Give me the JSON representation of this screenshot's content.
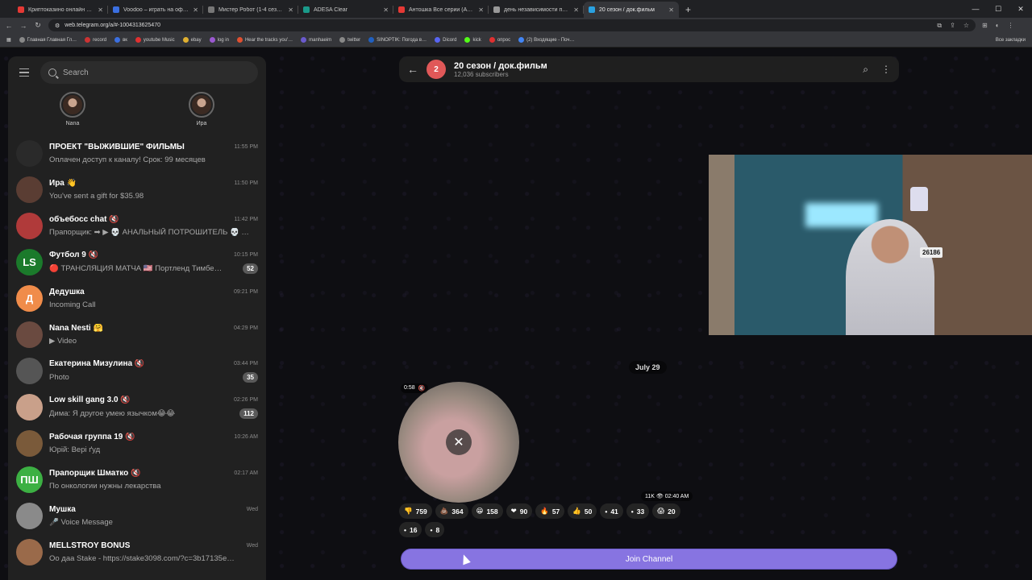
{
  "browser": {
    "tabs": [
      {
        "title": "Криптоказино онлайн VAVADA",
        "color": "#e53935"
      },
      {
        "title": "Voodoo – играть на официальн…",
        "color": "#3b6fe0"
      },
      {
        "title": "Мистер Робот (1-4 сезон) смотр…",
        "color": "#777777"
      },
      {
        "title": "ADESA Clear",
        "color": "#1a9a8a"
      },
      {
        "title": "Антошка Все серии (Antoshka)",
        "color": "#e53935"
      },
      {
        "title": "день независимости пакистан…",
        "color": "#999999"
      },
      {
        "title": "20 сезон / док.фильм",
        "color": "#2aa1e0"
      }
    ],
    "new_tab": "+",
    "url": "web.telegram.org/a/#-1004313625470",
    "bookmarks": [
      "Главная Главная Гл…",
      "record",
      "вк",
      "youtube Music",
      "ebay",
      "log in",
      "Hear the tracks you'…",
      "manhaeim",
      "twitter",
      "SINOPTIK: Погода в…",
      "Dicord",
      "kick",
      "опрос",
      "(2) Входящие - Поч…"
    ],
    "all_bookmarks": "Все закладки"
  },
  "sidebar": {
    "search_placeholder": "Search",
    "stories": [
      {
        "name": "Nana"
      },
      {
        "name": "Ира"
      }
    ],
    "chats": [
      {
        "name": "ПРОЕКТ \"ВЫЖИВШИЕ\" ФИЛЬМЫ",
        "preview": "Оплачен доступ к каналу! Срок: 99 месяцев",
        "time": "11:55 PM",
        "badge": "",
        "avatar_color": "#2a2a2a",
        "avatar_text": ""
      },
      {
        "name": "Ира 👋",
        "preview": "You've sent a gift for $35.98",
        "time": "11:50 PM",
        "badge": "",
        "avatar_color": "#5a3d33",
        "avatar_text": ""
      },
      {
        "name": "объебосс chat 🔇",
        "preview": "Прапорщик: ➡ ▶ 💀 АНАЛЬНЫЙ ПОТРОШИТЕЛЬ 💀 …",
        "time": "11:42 PM",
        "badge": "",
        "avatar_color": "#b03a3a",
        "avatar_text": ""
      },
      {
        "name": "Футбол 9 🔇",
        "preview": "🔴 ТРАНСЛЯЦИЯ МАТЧА 🇺🇸 Портленд Тимбе…",
        "time": "10:15 PM",
        "badge": "52",
        "avatar_color": "#1b7a2b",
        "avatar_text": "LS"
      },
      {
        "name": "Дедушка",
        "preview": "Incoming Call",
        "time": "09:21 PM",
        "badge": "",
        "avatar_color": "#f08c4a",
        "avatar_text": "Д"
      },
      {
        "name": "Nana Nesti 🤗",
        "preview": "▶ Video",
        "time": "04:29 PM",
        "badge": "",
        "avatar_color": "#6a4a40",
        "avatar_text": ""
      },
      {
        "name": "Екатерина Мизулина 🔇",
        "preview": "Photo",
        "time": "03:44 PM",
        "badge": "35",
        "avatar_color": "#555555",
        "avatar_text": ""
      },
      {
        "name": "Low skill gang 3.0 🔇",
        "preview": "Дима: Я другое умею язычком😂😂",
        "time": "02:26 PM",
        "badge": "112",
        "avatar_color": "#c9a08a",
        "avatar_text": ""
      },
      {
        "name": "Рабочая группа 19 🔇",
        "preview": "Юрій: Вері ґуд",
        "time": "10:26 AM",
        "badge": "",
        "avatar_color": "#7a5a3a",
        "avatar_text": ""
      },
      {
        "name": "Прапорщик Шматко 🔇",
        "preview": "По онкологии нужны лекарства",
        "time": "02:17 AM",
        "badge": "",
        "avatar_color": "#3cb043",
        "avatar_text": "ПШ"
      },
      {
        "name": "Мушка",
        "preview": "🎤 Voice Message",
        "time": "Wed",
        "badge": "",
        "avatar_color": "#8a8a8a",
        "avatar_text": ""
      },
      {
        "name": "MELLSTROY BONUS",
        "preview": "Оо даа Stake - https://stake3098.com/?c=3b17135e…",
        "time": "Wed",
        "badge": "",
        "avatar_color": "#9a6a4a",
        "avatar_text": ""
      }
    ]
  },
  "channel": {
    "avatar_text": "2",
    "title": "20 сезон / док.фильм",
    "subscribers": "12,036 subscribers",
    "date": "July 29",
    "video_duration": "0:58",
    "views": "11K",
    "post_time": "02:40 AM",
    "reactions": [
      {
        "emoji": "👎",
        "count": "759"
      },
      {
        "emoji": "💩",
        "count": "364"
      },
      {
        "emoji": "😁",
        "count": "158"
      },
      {
        "emoji": "❤",
        "count": "90"
      },
      {
        "emoji": "🔥",
        "count": "57"
      },
      {
        "emoji": "👍",
        "count": "50"
      },
      {
        "emoji": "•",
        "count": "41"
      },
      {
        "emoji": "•",
        "count": "33"
      },
      {
        "emoji": "😱",
        "count": "20"
      },
      {
        "emoji": "•",
        "count": "16"
      },
      {
        "emoji": "•",
        "count": "8"
      }
    ],
    "join_label": "Join Channel"
  },
  "webcam": {
    "plate": "26186"
  },
  "colors": {
    "accent": "#8774e1",
    "sidebar_bg": "#212121"
  }
}
